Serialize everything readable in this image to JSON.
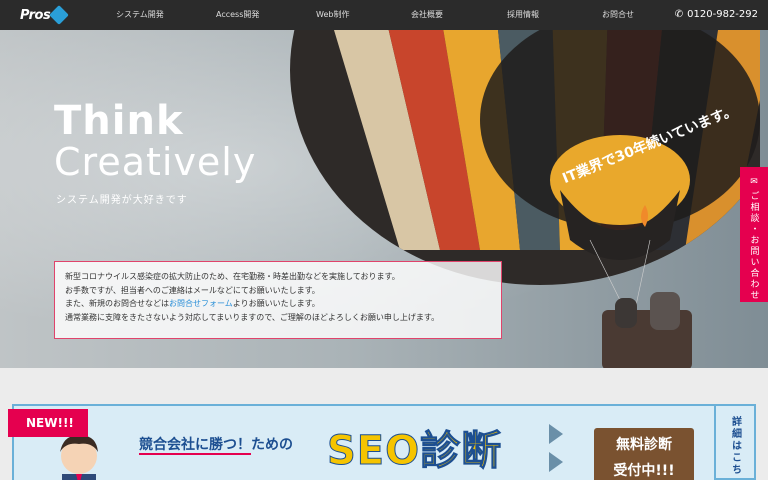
{
  "header": {
    "logo_text": "Pros",
    "nav": [
      "システム開発",
      "Access開発",
      "Web制作",
      "会社概要",
      "採用情報",
      "お問合せ"
    ],
    "phone": "0120-982-292"
  },
  "hero": {
    "headline_line1": "Think",
    "headline_line2": "Creatively",
    "tagline": "システム開発が大好きです",
    "balloon_text": "IT業界で30年続いています。"
  },
  "notice": {
    "line1": "新型コロナウイルス感染症の拡大防止のため、在宅勤務・時差出勤などを実施しております。",
    "line2": "お手数ですが、担当者へのご連絡はメールなどにてお願いいたします。",
    "line3_before": "また、新規のお問合せなどは",
    "line3_link": "お問合せフォーム",
    "line3_after": "よりお願いいたします。",
    "line4": "通常業務に支障をきたさないよう対応してまいりますので、ご理解のほどよろしくお願い申し上げます。"
  },
  "side_tab": {
    "label": "ご相談・お問い合わせ"
  },
  "banner": {
    "badge": "NEW!!!",
    "lead_part1": "競合会社に勝つ！",
    "lead_part2": "ための",
    "main": "SEO診断",
    "board_line1": "無料診断",
    "board_line2": "受付中!!!",
    "detail_tab": "詳細はこち"
  },
  "colors": {
    "accent": "#e5004f",
    "nav_bg": "#2b2b2b",
    "link": "#2a8fd8"
  }
}
